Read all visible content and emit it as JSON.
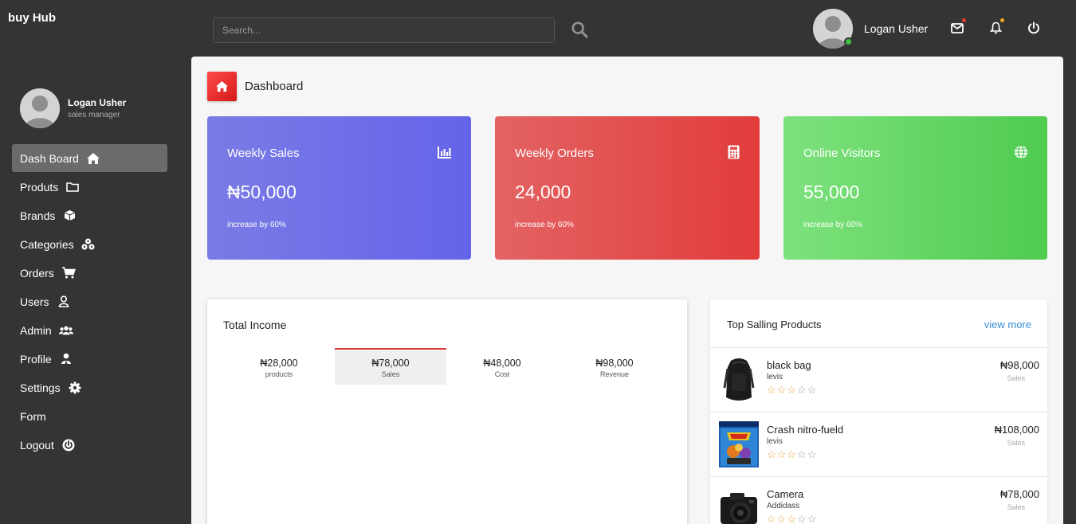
{
  "brand": "buy Hub",
  "search": {
    "placeholder": "Search..."
  },
  "top_user": {
    "name": "Logan Usher",
    "notification_colors": {
      "mail": "#e53935",
      "bell": "#f5a623"
    }
  },
  "sidebar": {
    "user_name": "Logan Usher",
    "user_role": "sales manager",
    "items": [
      {
        "label": "Dash Board",
        "icon": "home-icon",
        "active": true
      },
      {
        "label": "Produts",
        "icon": "folder-icon"
      },
      {
        "label": "Brands",
        "icon": "cube-icon"
      },
      {
        "label": "Categories",
        "icon": "cubes-icon"
      },
      {
        "label": "Orders",
        "icon": "cart-icon"
      },
      {
        "label": "Users",
        "icon": "user-icon"
      },
      {
        "label": "Admin",
        "icon": "users-icon"
      },
      {
        "label": "Profile",
        "icon": "profile-icon"
      },
      {
        "label": "Settings",
        "icon": "gear-icon"
      },
      {
        "label": "Form",
        "icon": ""
      },
      {
        "label": "Logout",
        "icon": "power-icon"
      }
    ]
  },
  "page": {
    "title": "Dashboard"
  },
  "cards": [
    {
      "title": "Weekly Sales",
      "value": "₦50,000",
      "note": "increase by 60%",
      "icon": "bar-chart-icon",
      "color": "#6b6bea"
    },
    {
      "title": "Weekly Orders",
      "value": "24,000",
      "note": "increase by 60%",
      "icon": "calculator-icon",
      "color": "#e24a4a"
    },
    {
      "title": "Online Visitors",
      "value": "55,000",
      "note": "increase by 60%",
      "icon": "globe-icon",
      "color": "#5ccf5c"
    }
  ],
  "income": {
    "title": "Total Income",
    "tabs": [
      {
        "value": "₦28,000",
        "label": "products"
      },
      {
        "value": "₦78,000",
        "label": "Sales",
        "active": true
      },
      {
        "value": "₦48,000",
        "label": "Cost"
      },
      {
        "value": "₦98,000",
        "label": "Revenue"
      }
    ]
  },
  "top_products": {
    "title": "Top Salling Products",
    "view_more": "view more",
    "items": [
      {
        "name": "black bag",
        "brand": "levis",
        "price": "₦98,000",
        "sub": "Sales",
        "rating": 3
      },
      {
        "name": "Crash nitro-fueld",
        "brand": "levis",
        "price": "₦108,000",
        "sub": "Sales",
        "rating": 3
      },
      {
        "name": "Camera",
        "brand": "Addidass",
        "price": "₦78,000",
        "sub": "Sales",
        "rating": 3
      }
    ]
  }
}
